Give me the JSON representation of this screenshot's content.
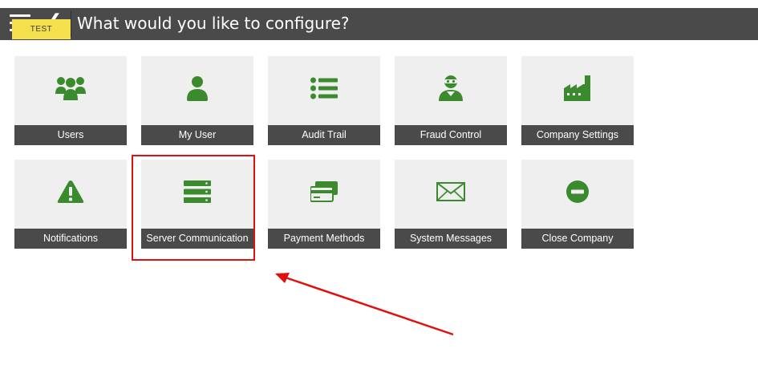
{
  "header": {
    "title": "What would you like to configure?",
    "badge": "TEST"
  },
  "colors": {
    "accent_green": "#3c8a2e",
    "header_bg": "#4a4a4a",
    "tile_bg": "#efefef",
    "badge_yellow": "#f4e04d",
    "highlight_red": "#e01010"
  },
  "tiles": [
    {
      "label": "Users",
      "icon": "users-icon"
    },
    {
      "label": "My User",
      "icon": "user-icon"
    },
    {
      "label": "Audit Trail",
      "icon": "list-icon"
    },
    {
      "label": "Fraud Control",
      "icon": "masked-user-icon"
    },
    {
      "label": "Company Settings",
      "icon": "factory-icon"
    },
    {
      "label": "Notifications",
      "icon": "warning-icon"
    },
    {
      "label": "Server Communication",
      "icon": "server-icon"
    },
    {
      "label": "Payment Methods",
      "icon": "credit-cards-icon"
    },
    {
      "label": "System Messages",
      "icon": "envelope-icon"
    },
    {
      "label": "Close Company",
      "icon": "minus-circle-icon"
    }
  ]
}
